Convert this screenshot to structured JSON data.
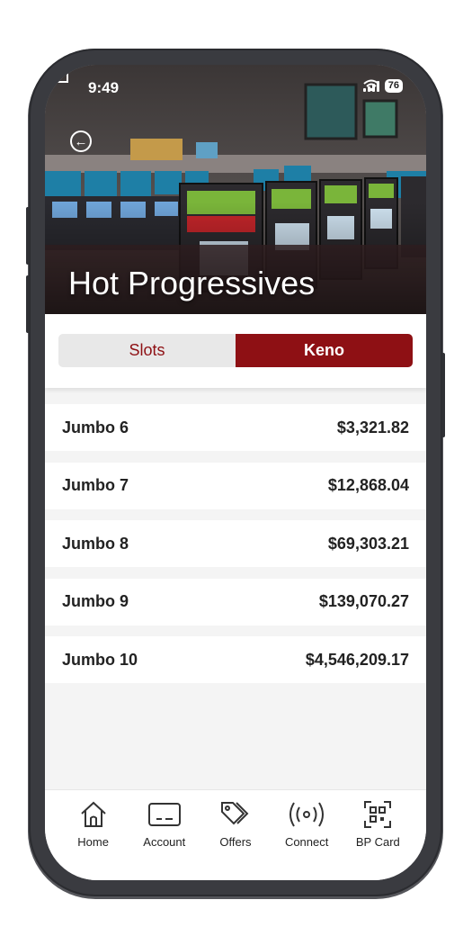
{
  "status": {
    "time": "9:49",
    "battery": "76"
  },
  "header": {
    "title": "Hot Progressives"
  },
  "tabs": [
    {
      "label": "Slots",
      "active": false
    },
    {
      "label": "Keno",
      "active": true
    }
  ],
  "rows": [
    {
      "name": "Jumbo 6",
      "amount": "$3,321.82"
    },
    {
      "name": "Jumbo 7",
      "amount": "$12,868.04"
    },
    {
      "name": "Jumbo 8",
      "amount": "$69,303.21"
    },
    {
      "name": "Jumbo 9",
      "amount": "$139,070.27"
    },
    {
      "name": "Jumbo 10",
      "amount": "$4,546,209.17"
    }
  ],
  "nav": [
    {
      "label": "Home",
      "icon": "home-icon"
    },
    {
      "label": "Account",
      "icon": "card-icon"
    },
    {
      "label": "Offers",
      "icon": "tags-icon"
    },
    {
      "label": "Connect",
      "icon": "broadcast-icon"
    },
    {
      "label": "BP Card",
      "icon": "qr-scan-icon"
    }
  ],
  "colors": {
    "accent": "#8e1014",
    "frame": "#3a3b40",
    "background": "#f4f4f4"
  }
}
